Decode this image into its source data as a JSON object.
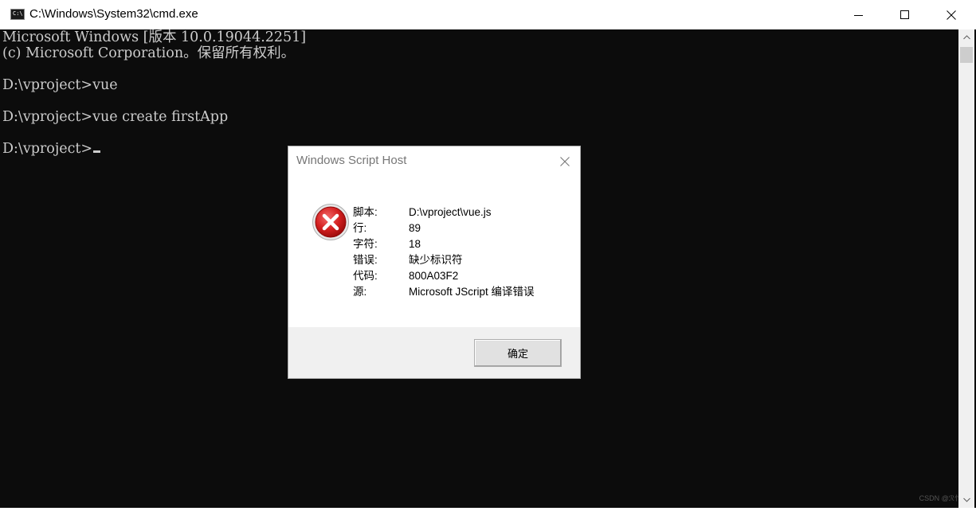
{
  "window": {
    "title": "C:\\Windows\\System32\\cmd.exe",
    "icon": "console-icon",
    "icon_text": "C:\\"
  },
  "console": {
    "lines": [
      "Microsoft Windows [版本 10.0.19044.2251]",
      "(c) Microsoft Corporation。保留所有权利。",
      "",
      "D:\\vproject>vue",
      "",
      "D:\\vproject>vue create firstApp",
      "",
      "D:\\vproject>"
    ],
    "text_color": "#cccccc",
    "background": "#0c0c0c"
  },
  "dialog": {
    "title": "Windows Script Host",
    "icon": "error-icon",
    "fields": [
      {
        "label": "脚本:",
        "value": "D:\\vproject\\vue.js"
      },
      {
        "label": "行:",
        "value": "89"
      },
      {
        "label": "字符:",
        "value": "18"
      },
      {
        "label": "错误:",
        "value": "缺少标识符"
      },
      {
        "label": "代码:",
        "value": "800A03F2"
      },
      {
        "label": "源:",
        "value": "Microsoft JScript 编译错误"
      }
    ],
    "ok_label": "确定"
  },
  "watermark": "CSDN @ℛ忄"
}
